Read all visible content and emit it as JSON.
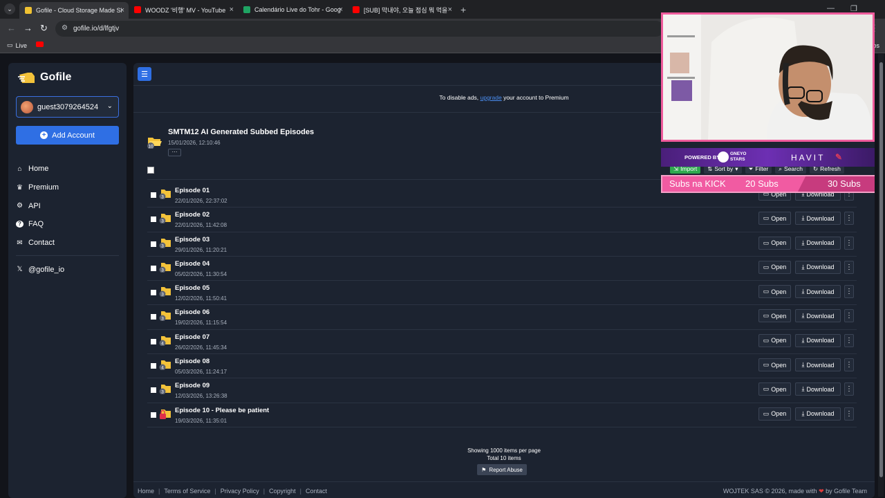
{
  "browser": {
    "tabs": [
      {
        "title": "Gofile - Cloud Storage Made Si",
        "active": true,
        "favicon_color": "#f0c232"
      },
      {
        "title": "WOODZ '비행' MV - YouTube",
        "active": false,
        "favicon_color": "#ff0000"
      },
      {
        "title": "Calendário Live do Tohr - Goog",
        "active": false,
        "favicon_color": "#1fa463"
      },
      {
        "title": "[SUB] 막내야, 오늘 점심 뭐 먹을",
        "active": false,
        "favicon_color": "#ff0000"
      }
    ],
    "tab_close": "×",
    "new_tab": "+",
    "url": "gofile.io/d/lfgtjv",
    "bookmarks": [
      {
        "label": "Live"
      }
    ],
    "bookmark_right": "os"
  },
  "sidebar": {
    "brand": "Gofile",
    "account_name": "guest3079264524",
    "add_account_label": "Add Account",
    "nav": [
      {
        "label": "Home",
        "icon": "home-icon"
      },
      {
        "label": "Premium",
        "icon": "crown-icon"
      },
      {
        "label": "API",
        "icon": "cogs-icon"
      },
      {
        "label": "FAQ",
        "icon": "question-icon"
      },
      {
        "label": "Contact",
        "icon": "envelope-icon"
      }
    ],
    "social": "@gofile_io"
  },
  "main": {
    "ads_prefix": "To disable ads,",
    "ads_link": "upgrade",
    "ads_suffix": "your account to Premium",
    "folder": {
      "title": "SMTM12 AI Generated Subbed Episodes",
      "date": "15/01/2026, 12:10:46",
      "count": "10",
      "more": "···"
    },
    "toolbar": {
      "import": "Import",
      "sort": "Sort by",
      "filter": "Filter",
      "search": "Search",
      "refresh": "Refresh"
    },
    "rows": [
      {
        "name": "Episode 01",
        "date": "22/01/2026, 22:37:02",
        "count": "3",
        "locked": false
      },
      {
        "name": "Episode 02",
        "date": "22/01/2026, 11:42:08",
        "count": "3",
        "locked": false
      },
      {
        "name": "Episode 03",
        "date": "29/01/2026, 11:20:21",
        "count": "3",
        "locked": false
      },
      {
        "name": "Episode 04",
        "date": "05/02/2026, 11:30:54",
        "count": "3",
        "locked": false
      },
      {
        "name": "Episode 05",
        "date": "12/02/2026, 11:50:41",
        "count": "3",
        "locked": false
      },
      {
        "name": "Episode 06",
        "date": "19/02/2026, 11:15:54",
        "count": "3",
        "locked": false
      },
      {
        "name": "Episode 07",
        "date": "26/02/2026, 11:45:34",
        "count": "4",
        "locked": false
      },
      {
        "name": "Episode 08",
        "date": "05/03/2026, 11:24:17",
        "count": "4",
        "locked": false
      },
      {
        "name": "Episode 09",
        "date": "12/03/2026, 13:26:38",
        "count": "3",
        "locked": false
      },
      {
        "name": "Episode 10 - Please be patient",
        "date": "19/03/2026, 11:35:01",
        "count": "",
        "locked": true
      }
    ],
    "open_label": "Open",
    "download_label": "Download",
    "summary_line1": "Showing 1000 items per page",
    "summary_line2": "Total 10 items",
    "report_label": "Report Abuse"
  },
  "footer": {
    "links": [
      "Home",
      "Terms of Service",
      "Privacy Policy",
      "Copyright",
      "Contact"
    ],
    "separator": "|",
    "copy_prefix": "WOJTEK SAS © 2026, made with",
    "copy_suffix": "by Gofile Team"
  },
  "overlay": {
    "sponsor_left": "POWERED BY",
    "sponsor_mid": "GNEYO STARS",
    "sponsor_right": "HAVIT",
    "subs_label": "Subs na KICK",
    "subs_goal1": "20 Subs",
    "subs_goal2": "30 Subs"
  },
  "colors": {
    "accent": "#2f6fe4",
    "panel": "#1c2330",
    "import_green": "#2fa84f",
    "overlay_pink": "#ef5b9c"
  }
}
